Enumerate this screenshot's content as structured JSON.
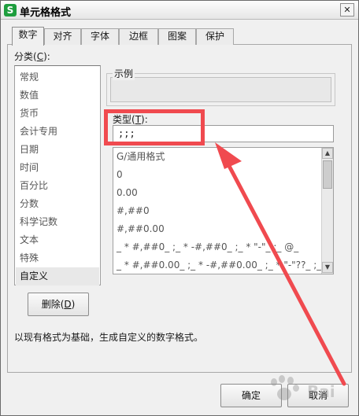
{
  "window": {
    "title": "单元格格式",
    "app_icon_glyph": "S",
    "close_glyph": "✕"
  },
  "tabs": [
    {
      "label": "数字",
      "active": true
    },
    {
      "label": "对齐",
      "active": false
    },
    {
      "label": "字体",
      "active": false
    },
    {
      "label": "边框",
      "active": false
    },
    {
      "label": "图案",
      "active": false
    },
    {
      "label": "保护",
      "active": false
    }
  ],
  "category": {
    "label": "分类(",
    "hotkey": "C",
    "label_end": "):",
    "items": [
      "常规",
      "数值",
      "货币",
      "会计专用",
      "日期",
      "时间",
      "百分比",
      "分数",
      "科学记数",
      "文本",
      "特殊",
      "自定义"
    ],
    "selected_index": 11
  },
  "sample": {
    "label": "示例"
  },
  "type": {
    "label": "类型(",
    "hotkey": "T",
    "label_end": "):",
    "value": ";;;"
  },
  "format_list": {
    "items": [
      "G/通用格式",
      "0",
      "0.00",
      "#,##0",
      "#,##0.00",
      "_ * #,##0_ ;_ * -#,##0_ ;_ * \"-\"_ ;_ @_",
      "_ * #,##0.00_ ;_ * -#,##0.00_ ;_ * \"-\"??_ ;_ @_"
    ]
  },
  "delete_button": {
    "label": "删除(",
    "hotkey": "D",
    "label_end": ")"
  },
  "description": "以现有格式为基础，生成自定义的数字格式。",
  "buttons": {
    "ok": "确定",
    "cancel": "取消"
  },
  "watermark": {
    "text": "Bai"
  },
  "colors": {
    "annotation": "#f04a4f",
    "icon_green": "#1e9e3e"
  }
}
